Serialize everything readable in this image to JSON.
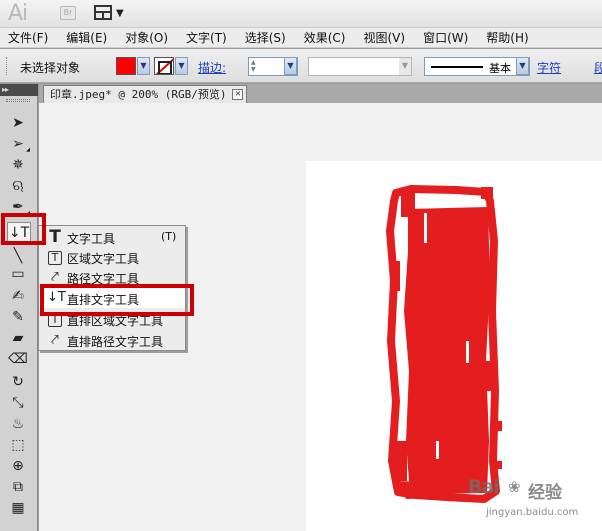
{
  "app": {
    "logo": "Ai",
    "bridge_button": "Br"
  },
  "menu": [
    "文件(F)",
    "编辑(E)",
    "对象(O)",
    "文字(T)",
    "选择(S)",
    "效果(C)",
    "视图(V)",
    "窗口(W)",
    "帮助(H)"
  ],
  "control_bar": {
    "selection_status": "未选择对象",
    "fill_color": "#ff0000",
    "stroke_label": "描边:",
    "stroke_weight": "",
    "brush_name": "基本",
    "character_link": "字符",
    "paragraph_link": "段"
  },
  "document": {
    "tab_title": "印章.jpeg* @ 200% (RGB/预览)",
    "close": "✕"
  },
  "toolbox": {
    "header": "▸▸"
  },
  "flyout": {
    "items": [
      {
        "icon": "T",
        "label": "文字工具",
        "shortcut": "(T)"
      },
      {
        "icon": "T",
        "label": "区域文字工具",
        "shortcut": ""
      },
      {
        "icon": "⤤",
        "label": "路径文字工具",
        "shortcut": ""
      },
      {
        "icon": "↓T",
        "label": "直排文字工具",
        "shortcut": ""
      },
      {
        "icon": "T",
        "label": "直排区域文字工具",
        "shortcut": ""
      },
      {
        "icon": "⤤",
        "label": "直排路径文字工具",
        "shortcut": ""
      }
    ],
    "active_index": 3
  },
  "highlight_color": "#cc0000",
  "seal_color": "#e41e1e",
  "watermark": {
    "brand": "Bai",
    "paw": "❀",
    "brand2": "经验",
    "url": "jingyan.baidu.com"
  }
}
